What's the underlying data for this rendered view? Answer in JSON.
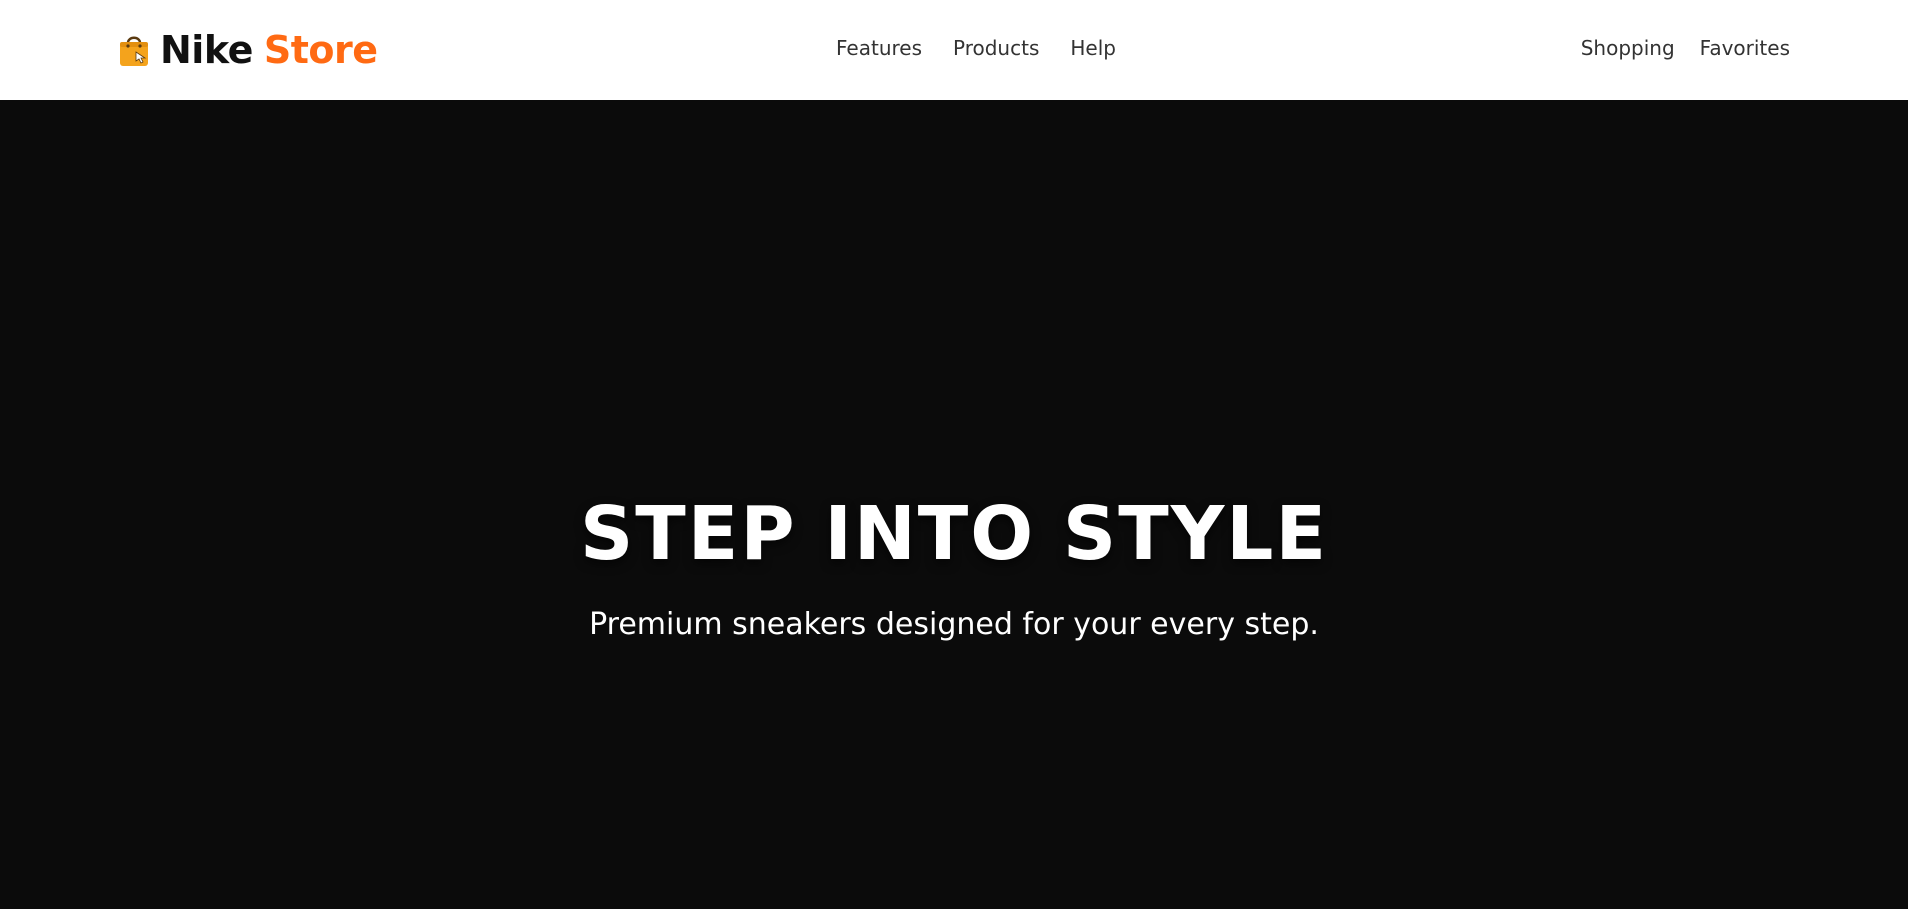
{
  "brand": {
    "icon": "shopping-bag-icon",
    "name": "Nike",
    "accent": "Store",
    "accent_color": "#ff6a13",
    "icon_color": "#f4a31c"
  },
  "nav": {
    "center_links": [
      {
        "label": "Features"
      },
      {
        "label": "Products"
      },
      {
        "label": "Help"
      }
    ],
    "right_links": [
      {
        "label": "Shopping"
      },
      {
        "label": "Favorites"
      }
    ]
  },
  "hero": {
    "title": "STEP INTO STYLE",
    "subtitle": "Premium sneakers designed for your every step.",
    "background_color": "#0b0b0b",
    "text_color": "#ffffff"
  }
}
